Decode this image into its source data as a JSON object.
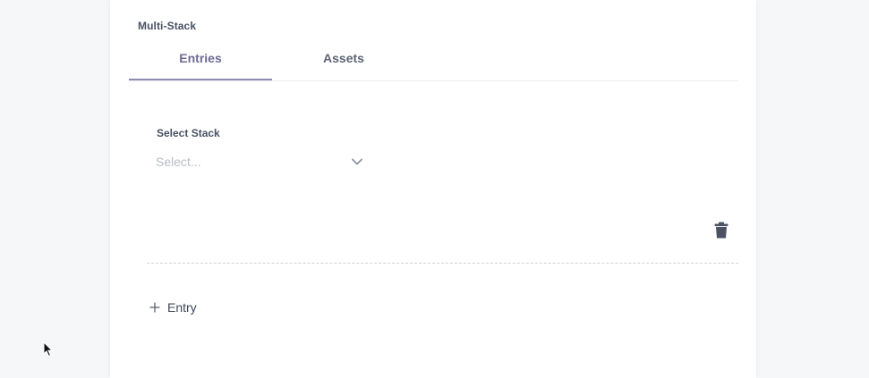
{
  "section": {
    "title": "Multi-Stack"
  },
  "tabs": [
    {
      "label": "Entries",
      "active": true
    },
    {
      "label": "Assets",
      "active": false
    }
  ],
  "select": {
    "label": "Select Stack",
    "placeholder": "Select..."
  },
  "actions": {
    "add_entry_label": "Entry",
    "delete_icon": "trash-icon",
    "add_icon": "plus-icon"
  },
  "colors": {
    "active_tab": "#6e6b94",
    "text": "#475161",
    "placeholder": "#b6bcc6",
    "background": "#f6f7f9"
  }
}
